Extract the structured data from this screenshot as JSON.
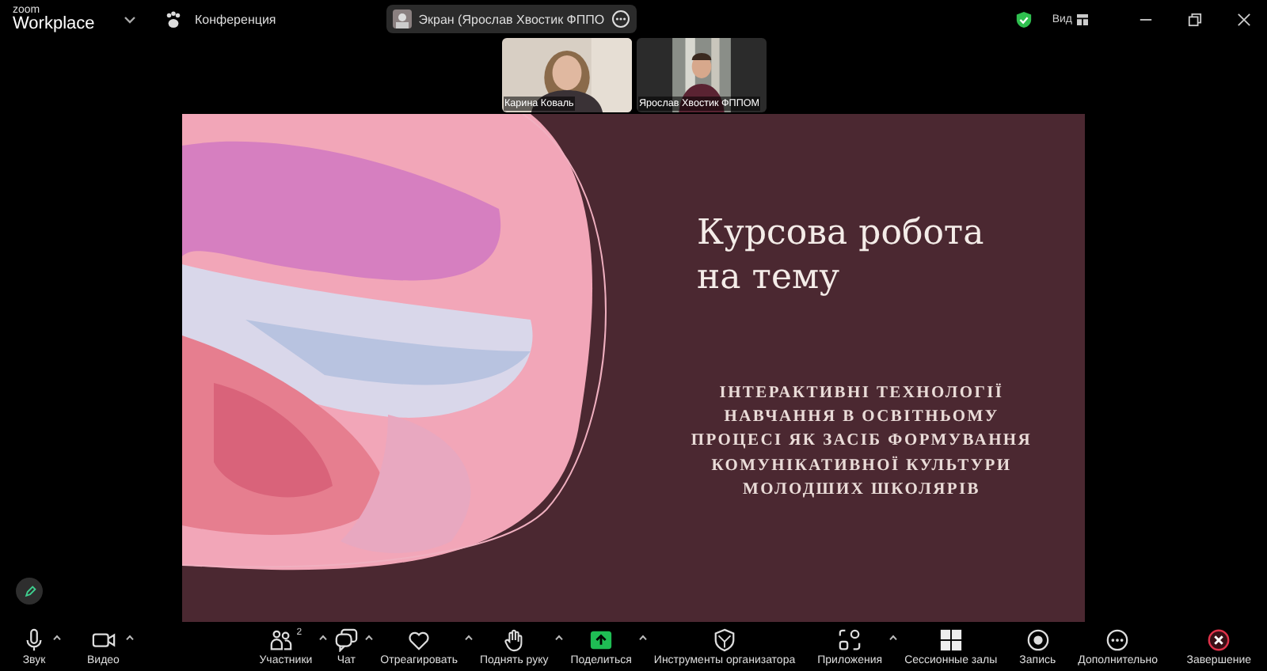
{
  "top_bar": {
    "logo_top": "zoom",
    "logo_bottom": "Workplace",
    "meeting": "Конференция",
    "share_pill": "Экран (Ярослав Хвостик ФППО",
    "view": "Вид"
  },
  "videos": [
    {
      "name": "Карина Коваль",
      "kind": "light"
    },
    {
      "name": "Ярослав Хвостик ФППОМ",
      "kind": "dark"
    }
  ],
  "slide": {
    "title": "Курсова робота\nна тему",
    "subtitle": "ІНТЕРАКТИВНІ ТЕХНОЛОГІЇ\nНАВЧАННЯ В ОСВІТНЬОМУ\nПРОЦЕСІ ЯК ЗАСІБ ФОРМУВАННЯ\nКОМУНІКАТИВНОЇ КУЛЬТУРИ\nМОЛОДШИХ ШКОЛЯРІВ"
  },
  "toolbar": {
    "left": [
      {
        "kind": "mic",
        "label": "Звук",
        "caret": true
      },
      {
        "kind": "video",
        "label": "Видео",
        "caret": true
      }
    ],
    "center": [
      {
        "kind": "participants",
        "label": "Участники",
        "count": "2",
        "caret": true
      },
      {
        "kind": "chat",
        "label": "Чат",
        "caret": true
      },
      {
        "kind": "react",
        "label": "Отреагировать",
        "caret": true
      },
      {
        "kind": "hand",
        "label": "Поднять руку",
        "caret": true
      },
      {
        "kind": "share",
        "label": "Поделиться",
        "caret": true
      },
      {
        "kind": "host",
        "label": "Инструменты организатора",
        "caret": false
      },
      {
        "kind": "apps",
        "label": "Приложения",
        "caret": true
      },
      {
        "kind": "rooms",
        "label": "Сессионные залы",
        "caret": false
      },
      {
        "kind": "record",
        "label": "Запись",
        "caret": false
      },
      {
        "kind": "more",
        "label": "Дополнительно",
        "caret": false
      }
    ],
    "right": [
      {
        "kind": "end",
        "label": "Завершение",
        "caret": false
      }
    ]
  }
}
